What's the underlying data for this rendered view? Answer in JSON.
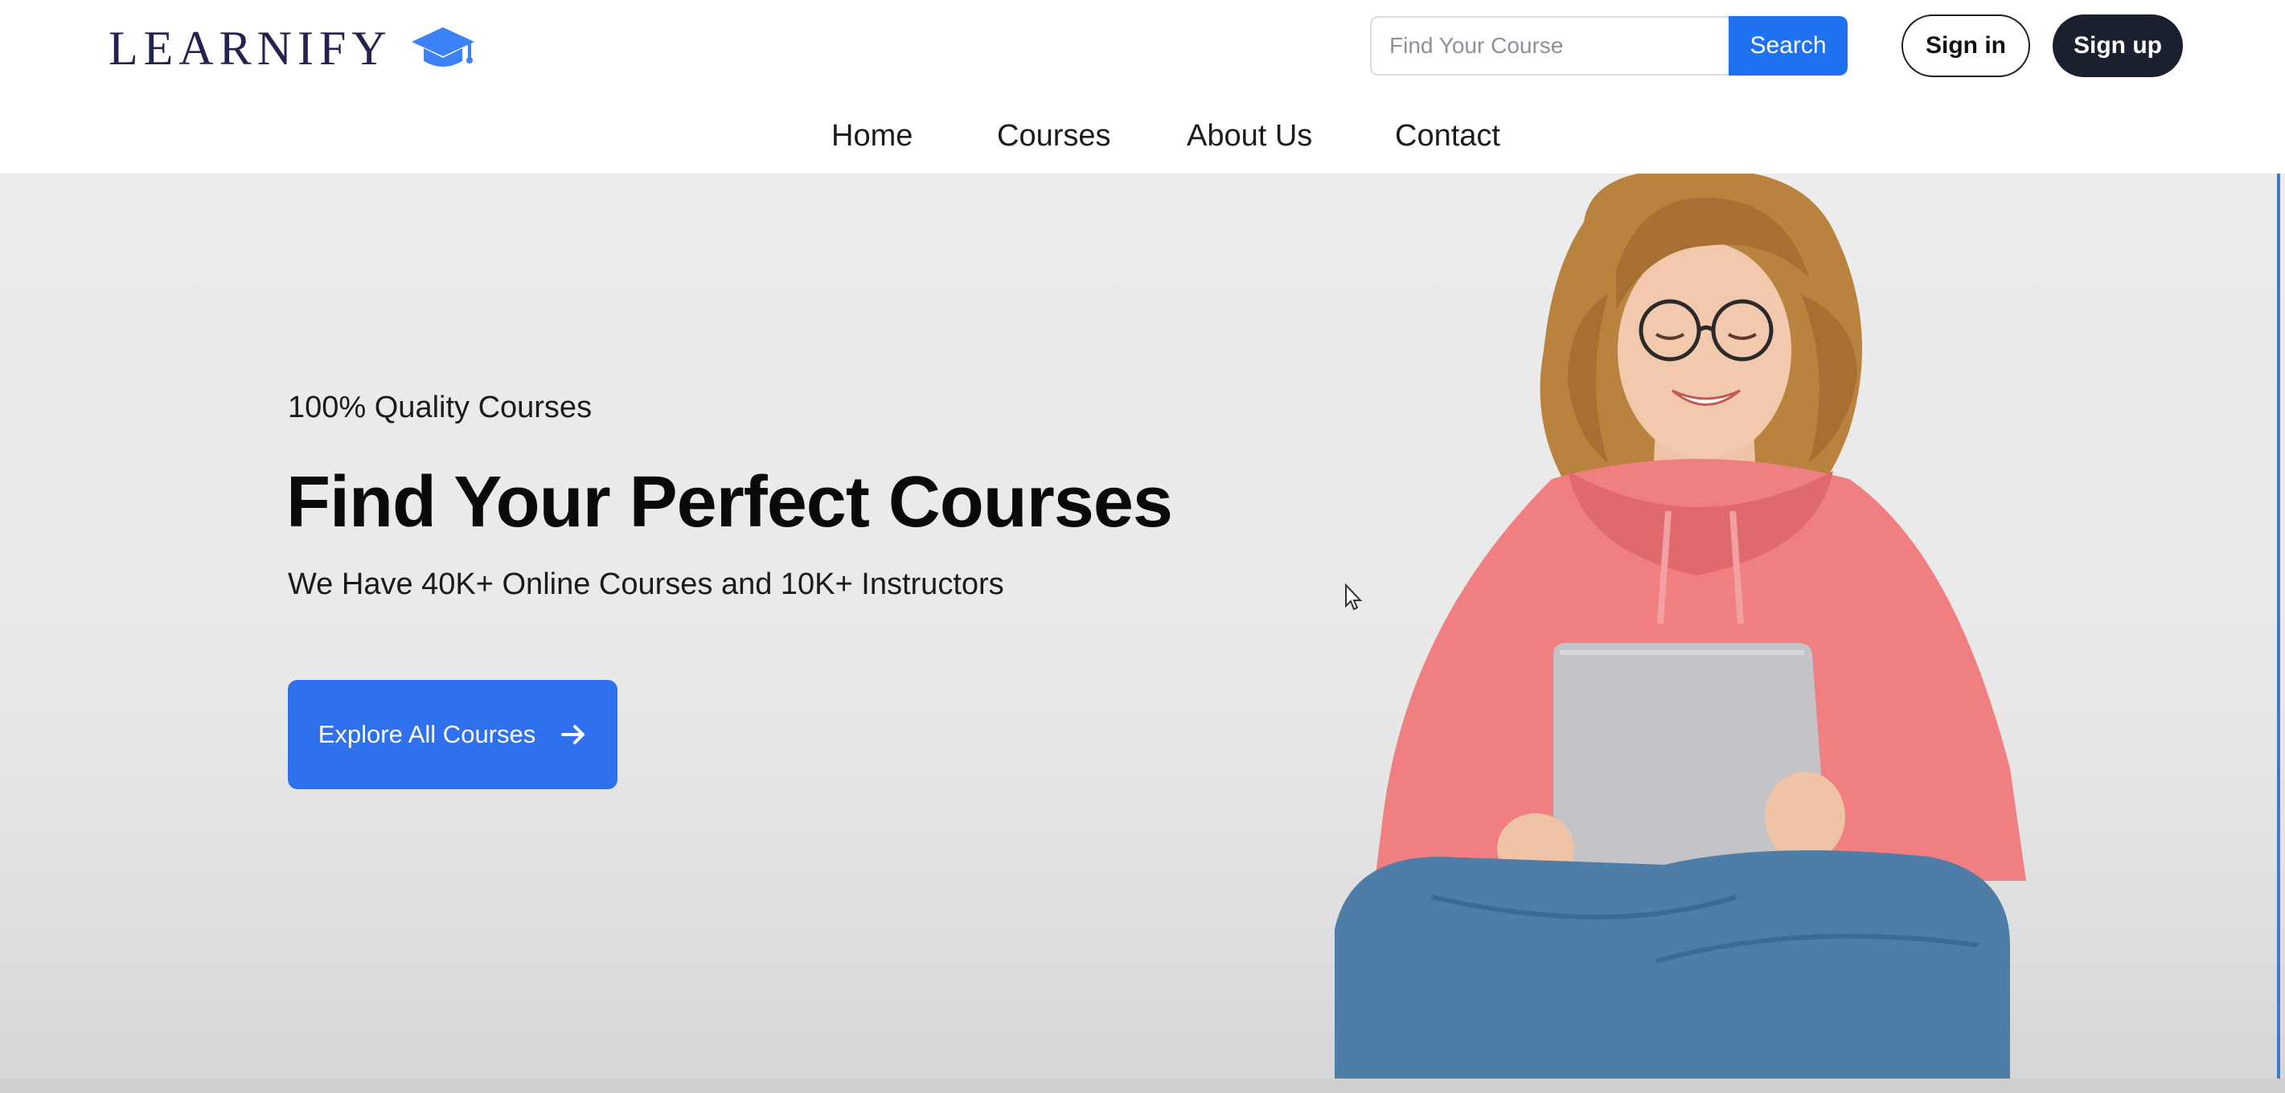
{
  "brand": {
    "name": "LEARNIFY",
    "icon": "graduation-cap-icon",
    "color": "#24224f"
  },
  "search": {
    "placeholder": "Find Your Course",
    "value": "",
    "button_label": "Search"
  },
  "auth": {
    "signin_label": "Sign in",
    "signup_label": "Sign up"
  },
  "nav": {
    "items": [
      {
        "label": "Home"
      },
      {
        "label": "Courses"
      },
      {
        "label": "About Us"
      },
      {
        "label": "Contact"
      }
    ]
  },
  "hero": {
    "tagline": "100% Quality Courses",
    "headline": "Find Your Perfect Courses",
    "subline": "We Have 40K+ Online Courses and 10K+ Instructors",
    "cta_label": "Explore All Courses",
    "cta_icon": "arrow-right-icon",
    "image_subject": "student-with-laptop-photo"
  },
  "colors": {
    "accent": "#1e72f0",
    "cta": "#2f70ec",
    "dark_button": "#1a202e",
    "hero_background": "#ececec"
  }
}
